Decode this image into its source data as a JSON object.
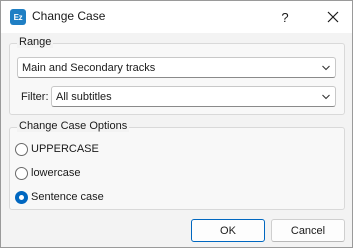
{
  "window": {
    "title": "Change Case",
    "app_icon_text": "Ez",
    "help_label": "?"
  },
  "range": {
    "legend": "Range",
    "tracks_value": "Main and Secondary tracks",
    "filter_label": "Filter:",
    "filter_value": "All subtitles"
  },
  "options": {
    "legend": "Change Case Options",
    "items": [
      {
        "label": "UPPERCASE",
        "checked": false
      },
      {
        "label": "lowercase",
        "checked": false
      },
      {
        "label": "Sentence case",
        "checked": true
      }
    ]
  },
  "buttons": {
    "ok": "OK",
    "cancel": "Cancel"
  },
  "colors": {
    "accent": "#0067c0",
    "app_icon": "#1f7fc4"
  }
}
